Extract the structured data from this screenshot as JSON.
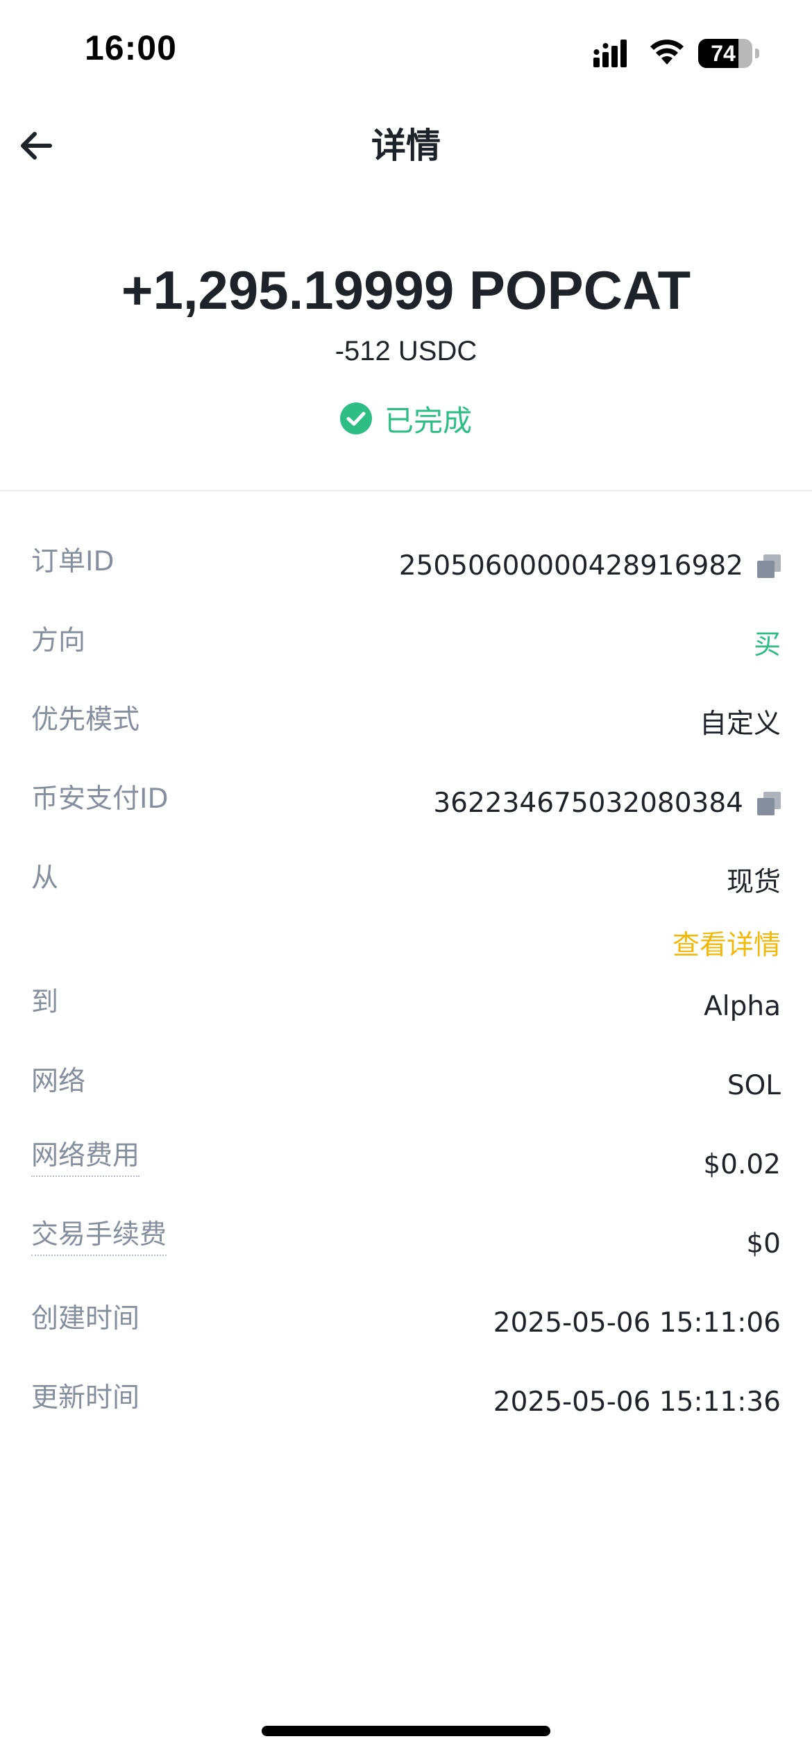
{
  "status_bar": {
    "time": "16:00",
    "battery_level": "74",
    "battery_fraction": 0.74
  },
  "header": {
    "title": "详情",
    "back_icon": "arrow-left-icon"
  },
  "summary": {
    "amount": "+1,295.19999 POPCAT",
    "sub_amount": "-512 USDC",
    "status": "已完成",
    "status_icon": "check-circle-icon",
    "status_color": "#2ebd85"
  },
  "details": {
    "order_id": {
      "label": "订单ID",
      "value": "250506000004289169​82"
    },
    "direction": {
      "label": "方向",
      "value": "买"
    },
    "priority_mode": {
      "label": "优先模式",
      "value": "自定义"
    },
    "binance_pay_id": {
      "label": "币安支付ID",
      "value": "362234675032080384"
    },
    "from": {
      "label": "从",
      "value": "现货",
      "link": "查看详情"
    },
    "to": {
      "label": "到",
      "value": "Alpha"
    },
    "network": {
      "label": "网络",
      "value": "SOL"
    },
    "network_fee": {
      "label": "网络费用",
      "value": "$0.02"
    },
    "trading_fee": {
      "label": "交易手续费",
      "value": "$0"
    },
    "created_time": {
      "label": "创建时间",
      "value": "2025-05-06 15:11:06"
    },
    "updated_time": {
      "label": "更新时间",
      "value": "2025-05-06 15:11:36"
    }
  },
  "colors": {
    "buy_green": "#2ebd85",
    "link_yellow": "#f0b90b",
    "label_gray": "#848e9c",
    "text_primary": "#1e2329"
  }
}
